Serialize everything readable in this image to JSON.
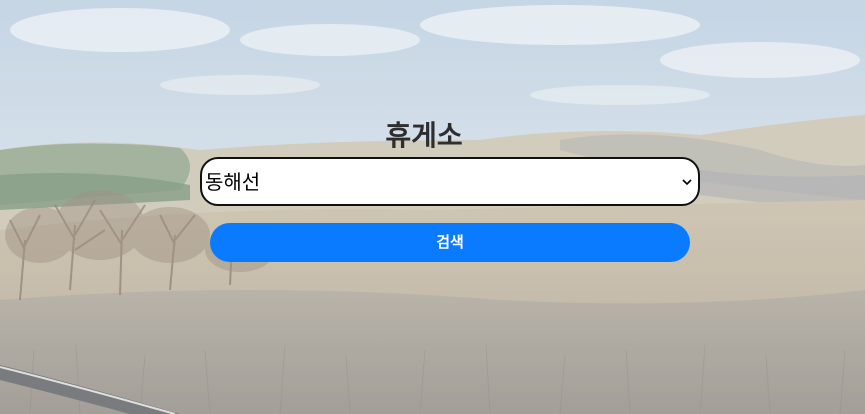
{
  "page": {
    "title": "휴게소"
  },
  "select": {
    "selected": "동해선",
    "icon": "chevron-down-icon"
  },
  "button": {
    "label": "검색",
    "color": "#0a7bff"
  },
  "background": {
    "description_icon": "landscape-photo"
  }
}
